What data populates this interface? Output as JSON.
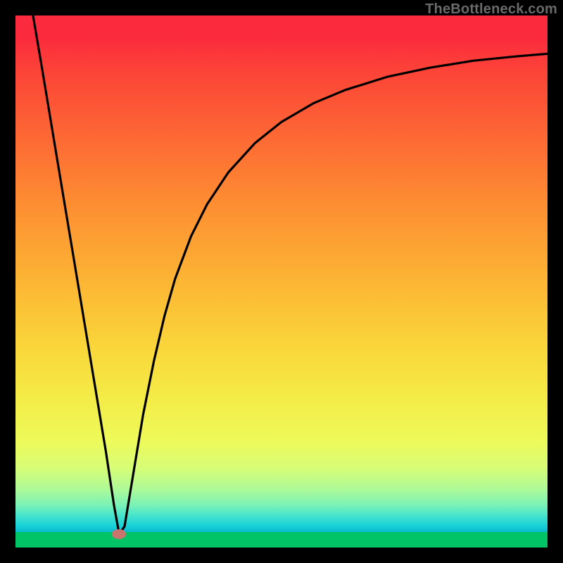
{
  "watermark": "TheBottleneck.com",
  "chart_data": {
    "type": "line",
    "title": "",
    "xlabel": "",
    "ylabel": "",
    "xlim": [
      0,
      100
    ],
    "ylim": [
      0,
      100
    ],
    "grid": false,
    "axes_visible": false,
    "marker": {
      "x": 19.5,
      "y": 2.5,
      "color": "#c9746c"
    },
    "curve_points": [
      {
        "x": 3.3,
        "y": 100.0
      },
      {
        "x": 5.0,
        "y": 90.0
      },
      {
        "x": 7.0,
        "y": 78.0
      },
      {
        "x": 9.0,
        "y": 66.0
      },
      {
        "x": 11.0,
        "y": 54.0
      },
      {
        "x": 13.0,
        "y": 42.0
      },
      {
        "x": 15.0,
        "y": 30.0
      },
      {
        "x": 17.0,
        "y": 18.0
      },
      {
        "x": 18.5,
        "y": 8.0
      },
      {
        "x": 19.5,
        "y": 2.5
      },
      {
        "x": 20.5,
        "y": 4.0
      },
      {
        "x": 22.0,
        "y": 13.0
      },
      {
        "x": 24.0,
        "y": 25.0
      },
      {
        "x": 26.0,
        "y": 35.0
      },
      {
        "x": 28.0,
        "y": 43.5
      },
      {
        "x": 30.0,
        "y": 50.5
      },
      {
        "x": 33.0,
        "y": 58.5
      },
      {
        "x": 36.0,
        "y": 64.5
      },
      {
        "x": 40.0,
        "y": 70.5
      },
      {
        "x": 45.0,
        "y": 76.0
      },
      {
        "x": 50.0,
        "y": 80.0
      },
      {
        "x": 56.0,
        "y": 83.5
      },
      {
        "x": 62.0,
        "y": 86.0
      },
      {
        "x": 70.0,
        "y": 88.5
      },
      {
        "x": 78.0,
        "y": 90.2
      },
      {
        "x": 86.0,
        "y": 91.5
      },
      {
        "x": 94.0,
        "y": 92.3
      },
      {
        "x": 100.0,
        "y": 92.8
      }
    ],
    "background_gradient": {
      "top": "#fb2a3d",
      "mid": "#fcb534",
      "low": "#edfa5a",
      "bottom": "#00c466"
    }
  }
}
